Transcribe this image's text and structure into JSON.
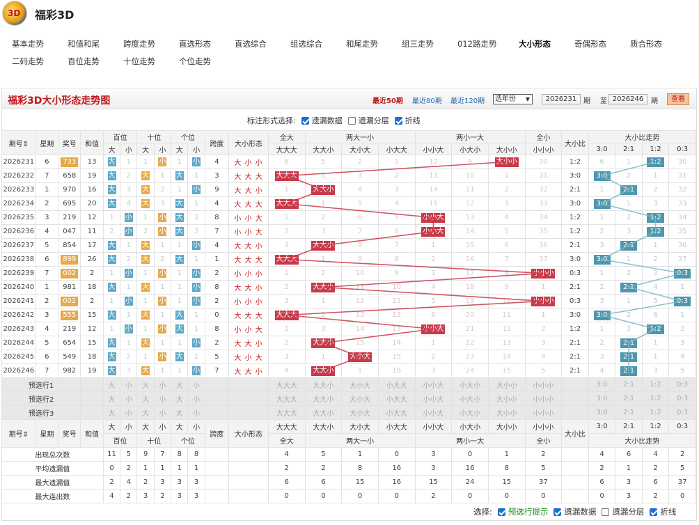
{
  "app": {
    "title": "福彩3D",
    "logo_text": "3D"
  },
  "nav": [
    {
      "label": "基本走势",
      "active": false
    },
    {
      "label": "和值和尾",
      "active": false
    },
    {
      "label": "跨度走势",
      "active": false
    },
    {
      "label": "直选形态",
      "active": false
    },
    {
      "label": "直选综合",
      "active": false
    },
    {
      "label": "组选综合",
      "active": false
    },
    {
      "label": "和尾走势",
      "active": false
    },
    {
      "label": "组三走势",
      "active": false
    },
    {
      "label": "012路走势",
      "active": false
    },
    {
      "label": "大小形态",
      "active": true
    },
    {
      "label": "奇偶形态",
      "active": false
    },
    {
      "label": "质合形态",
      "active": false
    },
    {
      "label": "二码走势",
      "active": false
    },
    {
      "label": "百位走势",
      "active": false
    },
    {
      "label": "十位走势",
      "active": false
    },
    {
      "label": "个位走势",
      "active": false
    }
  ],
  "panel": {
    "title": "福彩3D大小形态走势图",
    "recent": [
      "最近50期",
      "最近80期",
      "最近120期"
    ],
    "year_select": "选年份",
    "from_period": "2026231",
    "to_period": "2026246",
    "qi": "期",
    "zhi": "至",
    "query": "查看",
    "mark_label": "标注形式选择:",
    "mark_opts": [
      {
        "label": "遗漏数据",
        "on": true
      },
      {
        "label": "遗漏分层",
        "on": false
      },
      {
        "label": "折线",
        "on": true
      }
    ]
  },
  "headers": {
    "period": "期号",
    "week": "星期",
    "award": "奖号",
    "sum": "和值",
    "hundreds": "百位",
    "tens": "十位",
    "ones": "个位",
    "big": "大",
    "small": "小",
    "span": "跨度",
    "shape": "大小形态",
    "g_all_big": "全大",
    "g_two_big": "两大一小",
    "g_two_small": "两小一大",
    "g_all_small": "全小",
    "ratio": "大小比",
    "ratio_trend": "大小比走势",
    "sub_shapes": [
      "大大大",
      "大大小",
      "大小大",
      "小大大",
      "小小大",
      "小大小",
      "大小小",
      "小小小"
    ],
    "sub_ratios": [
      "3:0",
      "2:1",
      "1:2",
      "0:3"
    ]
  },
  "rows": [
    {
      "p": "2026231",
      "w": "6",
      "a": "733",
      "pz": true,
      "s": "13",
      "bh": [
        "大",
        "1"
      ],
      "bt": [
        "1",
        "小"
      ],
      "bo": [
        "1",
        "小"
      ],
      "span": "4",
      "shape": "大 小 小",
      "m": [
        "6",
        "5",
        "2",
        "1",
        "12",
        "9",
        "大小小",
        "30"
      ],
      "hit": 6,
      "r": "1:2",
      "rt": [
        "6",
        "1",
        "1:2",
        "30"
      ],
      "rh": 2
    },
    {
      "p": "2026232",
      "w": "7",
      "a": "658",
      "pz": false,
      "s": "19",
      "bh": [
        "大",
        "2"
      ],
      "bt": [
        "大",
        "1"
      ],
      "bo": [
        "大",
        "1"
      ],
      "span": "3",
      "shape": "大 大 大",
      "m": [
        "大大大",
        "6",
        "3",
        "2",
        "13",
        "10",
        "1",
        "31"
      ],
      "hit": 0,
      "r": "3:0",
      "rt": [
        "3:0",
        "2",
        "1",
        "31"
      ],
      "rh": 0
    },
    {
      "p": "2026233",
      "w": "1",
      "a": "970",
      "pz": false,
      "s": "16",
      "bh": [
        "大",
        "3"
      ],
      "bt": [
        "大",
        "2"
      ],
      "bo": [
        "1",
        "小"
      ],
      "span": "9",
      "shape": "大 大 小",
      "m": [
        "1",
        "大大小",
        "4",
        "3",
        "14",
        "11",
        "2",
        "32"
      ],
      "hit": 1,
      "r": "2:1",
      "rt": [
        "1",
        "2:1",
        "2",
        "32"
      ],
      "rh": 1
    },
    {
      "p": "2026234",
      "w": "2",
      "a": "695",
      "pz": false,
      "s": "20",
      "bh": [
        "大",
        "4"
      ],
      "bt": [
        "大",
        "3"
      ],
      "bo": [
        "大",
        "1"
      ],
      "span": "4",
      "shape": "大 大 大",
      "m": [
        "大大大",
        "1",
        "5",
        "4",
        "15",
        "12",
        "3",
        "33"
      ],
      "hit": 0,
      "r": "3:0",
      "rt": [
        "3:0",
        "1",
        "3",
        "33"
      ],
      "rh": 0
    },
    {
      "p": "2026235",
      "w": "3",
      "a": "219",
      "pz": false,
      "s": "12",
      "bh": [
        "1",
        "小"
      ],
      "bt": [
        "1",
        "小"
      ],
      "bo": [
        "大",
        "2"
      ],
      "span": "8",
      "shape": "小 小 大",
      "m": [
        "1",
        "2",
        "6",
        "5",
        "小小大",
        "13",
        "4",
        "34"
      ],
      "hit": 4,
      "r": "1:2",
      "rt": [
        "1",
        "2",
        "1:2",
        "34"
      ],
      "rh": 2
    },
    {
      "p": "2026236",
      "w": "4",
      "a": "047",
      "pz": false,
      "s": "11",
      "bh": [
        "2",
        "小"
      ],
      "bt": [
        "2",
        "小"
      ],
      "bo": [
        "大",
        "3"
      ],
      "span": "7",
      "shape": "小 小 大",
      "m": [
        "2",
        "3",
        "7",
        "6",
        "小小大",
        "14",
        "5",
        "35"
      ],
      "hit": 4,
      "r": "1:2",
      "rt": [
        "2",
        "3",
        "1:2",
        "35"
      ],
      "rh": 2
    },
    {
      "p": "2026237",
      "w": "5",
      "a": "854",
      "pz": false,
      "s": "17",
      "bh": [
        "大",
        "1"
      ],
      "bt": [
        "大",
        "1"
      ],
      "bo": [
        "1",
        "小"
      ],
      "span": "4",
      "shape": "大 大 小",
      "m": [
        "3",
        "大大小",
        "8",
        "7",
        "1",
        "15",
        "6",
        "36"
      ],
      "hit": 1,
      "r": "2:1",
      "rt": [
        "3",
        "2:1",
        "1",
        "36"
      ],
      "rh": 1
    },
    {
      "p": "2026238",
      "w": "6",
      "a": "899",
      "pz": true,
      "s": "26",
      "bh": [
        "大",
        "2"
      ],
      "bt": [
        "大",
        "2"
      ],
      "bo": [
        "大",
        "1"
      ],
      "span": "1",
      "shape": "大 大 大",
      "m": [
        "大大大",
        "1",
        "9",
        "8",
        "2",
        "16",
        "7",
        "37"
      ],
      "hit": 0,
      "r": "3:0",
      "rt": [
        "3:0",
        "1",
        "2",
        "37"
      ],
      "rh": 0
    },
    {
      "p": "2026239",
      "w": "7",
      "a": "002",
      "pz": true,
      "s": "2",
      "bh": [
        "1",
        "小"
      ],
      "bt": [
        "1",
        "小"
      ],
      "bo": [
        "1",
        "小"
      ],
      "span": "2",
      "shape": "小 小 小",
      "m": [
        "1",
        "2",
        "10",
        "9",
        "3",
        "17",
        "8",
        "小小小"
      ],
      "hit": 7,
      "r": "0:3",
      "rt": [
        "1",
        "2",
        "3",
        "0:3"
      ],
      "rh": 3
    },
    {
      "p": "2026240",
      "w": "1",
      "a": "981",
      "pz": false,
      "s": "18",
      "bh": [
        "大",
        "1"
      ],
      "bt": [
        "大",
        "1"
      ],
      "bo": [
        "1",
        "小"
      ],
      "span": "8",
      "shape": "大 大 小",
      "m": [
        "2",
        "大大小",
        "11",
        "10",
        "4",
        "18",
        "9",
        "1"
      ],
      "hit": 1,
      "r": "2:1",
      "rt": [
        "2",
        "2:1",
        "4",
        "1"
      ],
      "rh": 1
    },
    {
      "p": "2026241",
      "w": "2",
      "a": "002",
      "pz": true,
      "s": "2",
      "bh": [
        "1",
        "小"
      ],
      "bt": [
        "1",
        "小"
      ],
      "bo": [
        "1",
        "小"
      ],
      "span": "2",
      "shape": "小 小 小",
      "m": [
        "3",
        "1",
        "12",
        "11",
        "5",
        "19",
        "10",
        "小小小"
      ],
      "hit": 7,
      "r": "0:3",
      "rt": [
        "3",
        "1",
        "5",
        "0:3"
      ],
      "rh": 3
    },
    {
      "p": "2026242",
      "w": "3",
      "a": "555",
      "pz": true,
      "s": "15",
      "bh": [
        "大",
        "1"
      ],
      "bt": [
        "大",
        "1"
      ],
      "bo": [
        "大",
        "1"
      ],
      "span": "0",
      "shape": "大 大 大",
      "m": [
        "大大大",
        "2",
        "13",
        "12",
        "6",
        "20",
        "11",
        "1"
      ],
      "hit": 0,
      "r": "3:0",
      "rt": [
        "3:0",
        "2",
        "6",
        "1"
      ],
      "rh": 0
    },
    {
      "p": "2026243",
      "w": "4",
      "a": "219",
      "pz": false,
      "s": "12",
      "bh": [
        "1",
        "小"
      ],
      "bt": [
        "1",
        "小"
      ],
      "bo": [
        "大",
        "1"
      ],
      "span": "8",
      "shape": "小 小 大",
      "m": [
        "1",
        "3",
        "14",
        "13",
        "小小大",
        "21",
        "12",
        "2"
      ],
      "hit": 4,
      "r": "1:2",
      "rt": [
        "1",
        "3",
        "1:2",
        "2"
      ],
      "rh": 2
    },
    {
      "p": "2026244",
      "w": "5",
      "a": "654",
      "pz": false,
      "s": "15",
      "bh": [
        "大",
        "1"
      ],
      "bt": [
        "大",
        "1"
      ],
      "bo": [
        "1",
        "小"
      ],
      "span": "2",
      "shape": "大 大 小",
      "m": [
        "2",
        "大大小",
        "15",
        "14",
        "1",
        "22",
        "13",
        "3"
      ],
      "hit": 1,
      "r": "2:1",
      "rt": [
        "2",
        "2:1",
        "1",
        "3"
      ],
      "rh": 1
    },
    {
      "p": "2026245",
      "w": "6",
      "a": "549",
      "pz": false,
      "s": "18",
      "bh": [
        "大",
        "2"
      ],
      "bt": [
        "1",
        "小"
      ],
      "bo": [
        "大",
        "1"
      ],
      "span": "5",
      "shape": "大 小 大",
      "m": [
        "3",
        "1",
        "大小大",
        "15",
        "2",
        "23",
        "14",
        "4"
      ],
      "hit": 2,
      "r": "2:1",
      "rt": [
        "3",
        "2:1",
        "1",
        "4"
      ],
      "rh": 1
    },
    {
      "p": "2026246",
      "w": "7",
      "a": "982",
      "pz": false,
      "s": "19",
      "bh": [
        "大",
        "3"
      ],
      "bt": [
        "大",
        "1"
      ],
      "bo": [
        "1",
        "小"
      ],
      "span": "7",
      "shape": "大 大 小",
      "m": [
        "4",
        "大大小",
        "1",
        "16",
        "3",
        "24",
        "15",
        "5"
      ],
      "hit": 1,
      "r": "2:1",
      "rt": [
        "4",
        "2:1",
        "3",
        "5"
      ],
      "rh": 1
    }
  ],
  "predict": [
    "预选行1",
    "预选行2",
    "预选行3"
  ],
  "stats": [
    {
      "label": "出现总次数",
      "v": [
        "11",
        "5",
        "9",
        "7",
        "8",
        "8"
      ],
      "m": [
        "4",
        "5",
        "1",
        "0",
        "3",
        "0",
        "1",
        "2"
      ],
      "rt": [
        "4",
        "6",
        "4",
        "2"
      ]
    },
    {
      "label": "平均遗漏值",
      "v": [
        "0",
        "2",
        "1",
        "1",
        "1",
        "1"
      ],
      "m": [
        "2",
        "2",
        "8",
        "16",
        "3",
        "16",
        "8",
        "5"
      ],
      "rt": [
        "2",
        "1",
        "2",
        "5"
      ]
    },
    {
      "label": "最大遗漏值",
      "v": [
        "2",
        "4",
        "2",
        "3",
        "3",
        "3"
      ],
      "m": [
        "6",
        "6",
        "15",
        "16",
        "15",
        "24",
        "15",
        "37"
      ],
      "rt": [
        "6",
        "3",
        "6",
        "37"
      ]
    },
    {
      "label": "最大连出数",
      "v": [
        "4",
        "2",
        "3",
        "2",
        "3",
        "3"
      ],
      "m": [
        "0",
        "0",
        "0",
        "0",
        "2",
        "0",
        "0",
        "0"
      ],
      "rt": [
        "0",
        "3",
        "2",
        "0"
      ]
    }
  ],
  "bottom": {
    "label": "选择:",
    "opts": [
      {
        "label": "预选行提示",
        "on": true
      },
      {
        "label": "遗漏数据",
        "on": true
      },
      {
        "label": "遗漏分层",
        "on": false
      },
      {
        "label": "折线",
        "on": true
      }
    ]
  }
}
